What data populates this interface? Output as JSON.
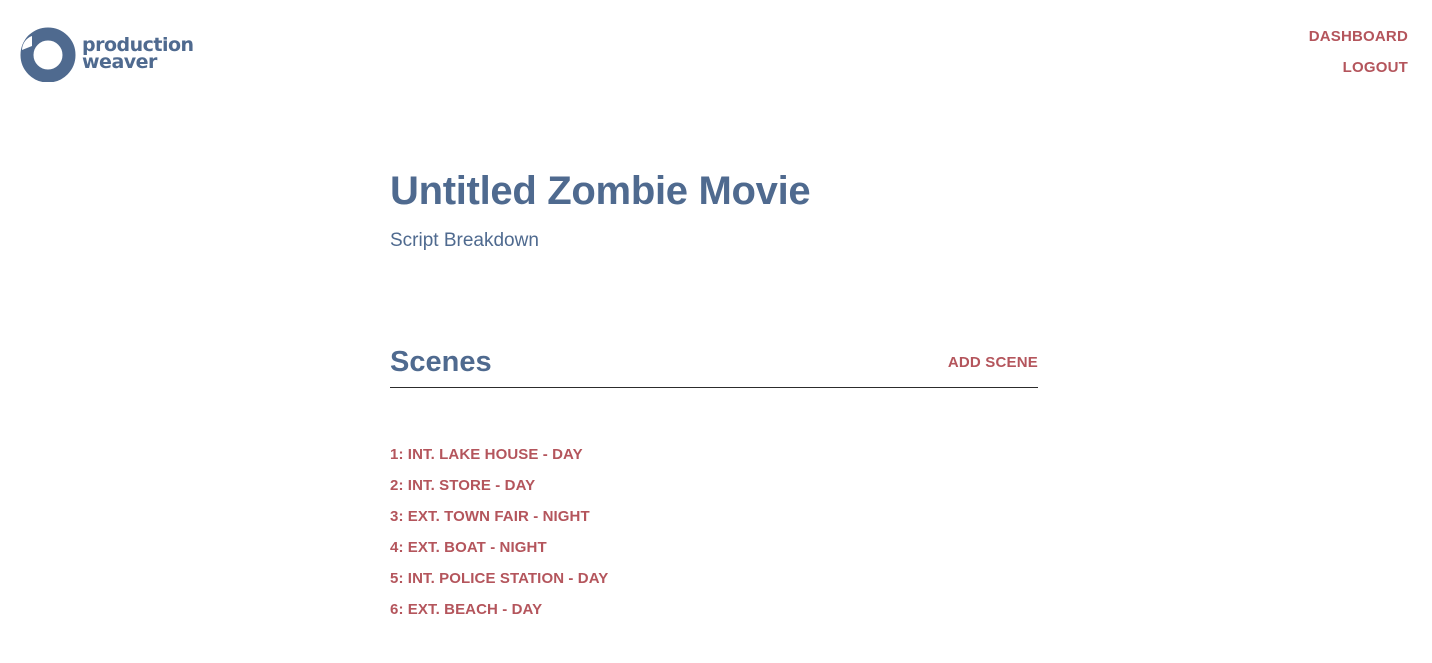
{
  "brand": {
    "line1": "production",
    "line2": "weaver",
    "logo_icon": "production-weaver-logo-icon",
    "color": "#4f6a8f"
  },
  "nav": {
    "dashboard": "DASHBOARD",
    "logout": "LOGOUT",
    "link_color": "#b4555c"
  },
  "page": {
    "title": "Untitled Zombie Movie",
    "subtitle": "Script Breakdown"
  },
  "scenes": {
    "heading": "Scenes",
    "add_label": "ADD SCENE",
    "items": [
      {
        "label": "1: INT. LAKE HOUSE - DAY"
      },
      {
        "label": "2: INT. STORE - DAY"
      },
      {
        "label": "3: EXT. TOWN FAIR - NIGHT"
      },
      {
        "label": "4: EXT. BOAT - NIGHT"
      },
      {
        "label": "5: INT. POLICE STATION - DAY"
      },
      {
        "label": "6: EXT. BEACH - DAY"
      }
    ]
  }
}
